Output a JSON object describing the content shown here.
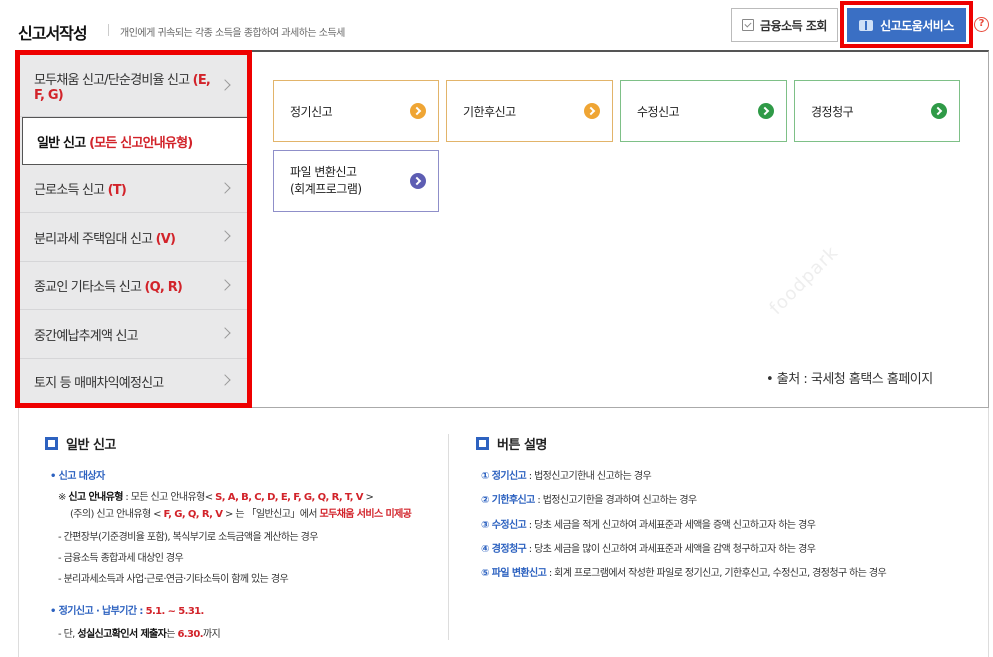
{
  "header": {
    "title": "신고서작성",
    "subtitle": "개인에게 귀속되는 각종 소득을 종합하여 과세하는 소득세",
    "financial_income_label": "금융소득 조회",
    "help_service_label": "신고도움서비스",
    "help_mark": "?"
  },
  "sidebar": {
    "items": [
      {
        "label": "모두채움 신고/단순경비율 신고 ",
        "code": "(E, F, G)"
      },
      {
        "label": "일반 신고 ",
        "code": "(모든 신고안내유형)"
      },
      {
        "label": "근로소득 신고 ",
        "code": "(T)"
      },
      {
        "label": "분리과세 주택임대 신고 ",
        "code": "(V)"
      },
      {
        "label": "종교인 기타소득 신고 ",
        "code": "(Q, R)"
      },
      {
        "label": "중간예납추계액 신고",
        "code": ""
      },
      {
        "label": "토지 등 매매차익예정신고",
        "code": ""
      }
    ]
  },
  "cards": [
    {
      "label": "정기신고",
      "color": "orange"
    },
    {
      "label": "기한후신고",
      "color": "orange"
    },
    {
      "label": "수정신고",
      "color": "green"
    },
    {
      "label": "경정청구",
      "color": "green"
    },
    {
      "label_line1": "파일 변환신고",
      "label_line2": "(회계프로그램)",
      "color": "purple"
    }
  ],
  "watermark": "foodpark",
  "source": "• 출처 : 국세청 홈택스 홈페이지",
  "general": {
    "title": "일반 신고",
    "target_label": "• 신고 대상자",
    "note1_prefix": "※ ",
    "note1_bold": "신고 안내유형",
    "note1_text": " : 모든 신고 안내유형< ",
    "note1_codes": "S, A, B, C, D, E, F, G, Q, R, T, V",
    "note1_end": " >",
    "note2_text": "(주의) 신고 안내유형 < ",
    "note2_codes": "F, G, Q, R, V",
    "note2_mid": " > 는 「일반신고」에서 ",
    "note2_red": "모두채움 서비스 미제공",
    "items": [
      "- 간편장부(기준경비율 포함), 복식부기로 소득금액을 계산하는 경우",
      "- 금융소득 종합과세 대상인 경우",
      "- 분리과세소득과 사업·근로·연금·기타소득이 함께 있는 경우"
    ],
    "period_label": "• 정기신고 · 납부기간 : ",
    "period_value": "5.1. ~ 5.31.",
    "period_note_prefix": "- 단, ",
    "period_note_bold": "성실신고확인서 제출자",
    "period_note_mid": "는 ",
    "period_note_date": "6.30.",
    "period_note_end": "까지"
  },
  "buttons_desc": {
    "title": "버튼 설명",
    "items": [
      {
        "num": "① ",
        "name": "정기신고",
        "desc": " : 법정신고기한내 신고하는 경우"
      },
      {
        "num": "② ",
        "name": "기한후신고",
        "desc": " : 법정신고기한을 경과하여 신고하는 경우"
      },
      {
        "num": "③ ",
        "name": "수정신고",
        "desc": " : 당초 세금을 적게 신고하여 과세표준과 세액을 증액 신고하고자 하는 경우"
      },
      {
        "num": "④ ",
        "name": "경정청구",
        "desc": " : 당초 세금을 많이 신고하여 과세표준과 세액을 감액 청구하고자 하는 경우"
      },
      {
        "num": "⑤ ",
        "name": "파일 변환신고",
        "desc": " : 회계 프로그램에서 작성한 파일로 정기신고, 기한후신고, 수정신고, 경정청구 하는 경우"
      }
    ]
  }
}
